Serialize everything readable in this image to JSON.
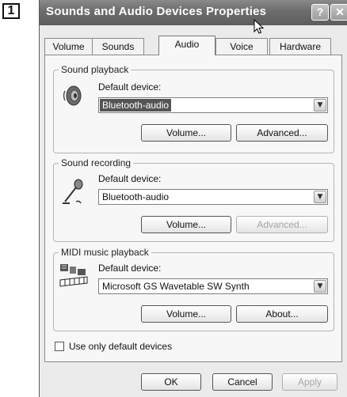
{
  "step_badge": "1",
  "window": {
    "title": "Sounds and Audio Devices Properties",
    "help_glyph": "?",
    "close_glyph": "✕"
  },
  "tabs": [
    {
      "label": "Volume",
      "active": false
    },
    {
      "label": "Sounds",
      "active": false
    },
    {
      "label": "Audio",
      "active": true
    },
    {
      "label": "Voice",
      "active": false
    },
    {
      "label": "Hardware",
      "active": false
    }
  ],
  "playback": {
    "group_label": "Sound playback",
    "device_label": "Default device:",
    "device_value": "Bluetooth-audio",
    "volume_button": "Volume...",
    "advanced_button": "Advanced..."
  },
  "recording": {
    "group_label": "Sound recording",
    "device_label": "Default device:",
    "device_value": "Bluetooth-audio",
    "volume_button": "Volume...",
    "advanced_button": "Advanced..."
  },
  "midi": {
    "group_label": "MIDI music playback",
    "device_label": "Default device:",
    "device_value": "Microsoft GS Wavetable SW Synth",
    "volume_button": "Volume...",
    "about_button": "About..."
  },
  "use_default_checkbox": {
    "label": "Use only default devices",
    "checked": false
  },
  "footer": {
    "ok": "OK",
    "cancel": "Cancel",
    "apply": "Apply"
  },
  "icons": {
    "dropdown_arrow": "▼",
    "speaker": "speaker-icon",
    "microphone": "microphone-icon",
    "midi": "midi-keyboard-icon",
    "cursor": "mouse-pointer-icon"
  }
}
